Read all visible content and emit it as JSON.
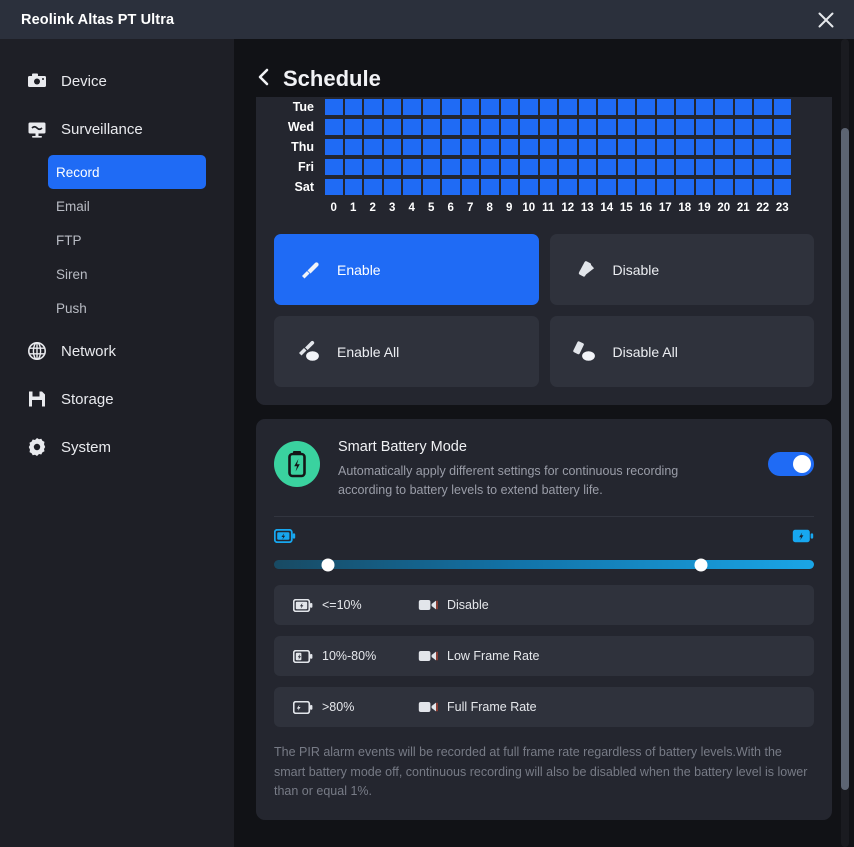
{
  "window": {
    "title": "Reolink Altas PT Ultra",
    "close_icon": "close-icon"
  },
  "sidebar": {
    "items": [
      {
        "label": "Device",
        "icon": "camera-icon"
      },
      {
        "label": "Surveillance",
        "icon": "monitor-icon"
      },
      {
        "label": "Network",
        "icon": "globe-icon"
      },
      {
        "label": "Storage",
        "icon": "floppy-disk-icon"
      },
      {
        "label": "System",
        "icon": "gear-icon"
      }
    ],
    "sub_items": [
      {
        "label": "Record",
        "active": true
      },
      {
        "label": "Email",
        "active": false
      },
      {
        "label": "FTP",
        "active": false
      },
      {
        "label": "Siren",
        "active": false
      },
      {
        "label": "Push",
        "active": false
      }
    ]
  },
  "page": {
    "title": "Schedule",
    "back_icon": "chevron-left-icon"
  },
  "schedule": {
    "days": [
      "Tue",
      "Wed",
      "Thu",
      "Fri",
      "Sat"
    ],
    "hours": [
      "0",
      "1",
      "2",
      "3",
      "4",
      "5",
      "6",
      "7",
      "8",
      "9",
      "10",
      "11",
      "12",
      "13",
      "14",
      "15",
      "16",
      "17",
      "18",
      "19",
      "20",
      "21",
      "22",
      "23"
    ],
    "enabled_color": "#1f6bf5",
    "rows": [
      {
        "day": "Tue",
        "cells": [
          1,
          1,
          1,
          1,
          1,
          1,
          1,
          1,
          1,
          1,
          1,
          1,
          1,
          1,
          1,
          1,
          1,
          1,
          1,
          1,
          1,
          1,
          1,
          1
        ]
      },
      {
        "day": "Wed",
        "cells": [
          1,
          1,
          1,
          1,
          1,
          1,
          1,
          1,
          1,
          1,
          1,
          1,
          1,
          1,
          1,
          1,
          1,
          1,
          1,
          1,
          1,
          1,
          1,
          1
        ]
      },
      {
        "day": "Thu",
        "cells": [
          1,
          1,
          1,
          1,
          1,
          1,
          1,
          1,
          1,
          1,
          1,
          1,
          1,
          1,
          1,
          1,
          1,
          1,
          1,
          1,
          1,
          1,
          1,
          1
        ]
      },
      {
        "day": "Fri",
        "cells": [
          1,
          1,
          1,
          1,
          1,
          1,
          1,
          1,
          1,
          1,
          1,
          1,
          1,
          1,
          1,
          1,
          1,
          1,
          1,
          1,
          1,
          1,
          1,
          1
        ]
      },
      {
        "day": "Sat",
        "cells": [
          1,
          1,
          1,
          1,
          1,
          1,
          1,
          1,
          1,
          1,
          1,
          1,
          1,
          1,
          1,
          1,
          1,
          1,
          1,
          1,
          1,
          1,
          1,
          1
        ]
      }
    ]
  },
  "actions": [
    {
      "label": "Enable",
      "icon": "paintbrush-icon",
      "primary": true
    },
    {
      "label": "Disable",
      "icon": "eraser-icon",
      "primary": false
    },
    {
      "label": "Enable All",
      "icon": "paintbrush-all-icon",
      "primary": false
    },
    {
      "label": "Disable All",
      "icon": "eraser-all-icon",
      "primary": false
    }
  ],
  "battery": {
    "icon": "battery-bolt-icon",
    "icon_bg": "#3ad29f",
    "title": "Smart Battery Mode",
    "description": "Automatically apply different settings for continuous recording according to battery levels to extend battery life.",
    "toggle_on": true,
    "toggle_color": "#1f6bf5",
    "slider": {
      "left_icon": "battery-low-icon",
      "right_icon": "battery-full-icon",
      "handle_left_pct": 10,
      "handle_right_pct": 79
    },
    "levels": [
      {
        "battery_icon": "battery-empty-icon",
        "range": "<=10%",
        "camera_icon": "video-camera-icon",
        "mode": "Disable"
      },
      {
        "battery_icon": "battery-half-icon",
        "range": "10%-80%",
        "camera_icon": "video-camera-icon",
        "mode": "Low Frame Rate"
      },
      {
        "battery_icon": "battery-full-icon",
        "range": ">80%",
        "camera_icon": "video-camera-icon",
        "mode": "Full Frame Rate"
      }
    ],
    "note": "The PIR alarm events will be recorded at full frame rate regardless of battery levels.With the smart battery mode off, continuous recording will also be disabled when the battery level is lower than or equal 1%."
  },
  "scrollbar": {
    "thumb_top_pct": 11,
    "thumb_height_pct": 82
  }
}
